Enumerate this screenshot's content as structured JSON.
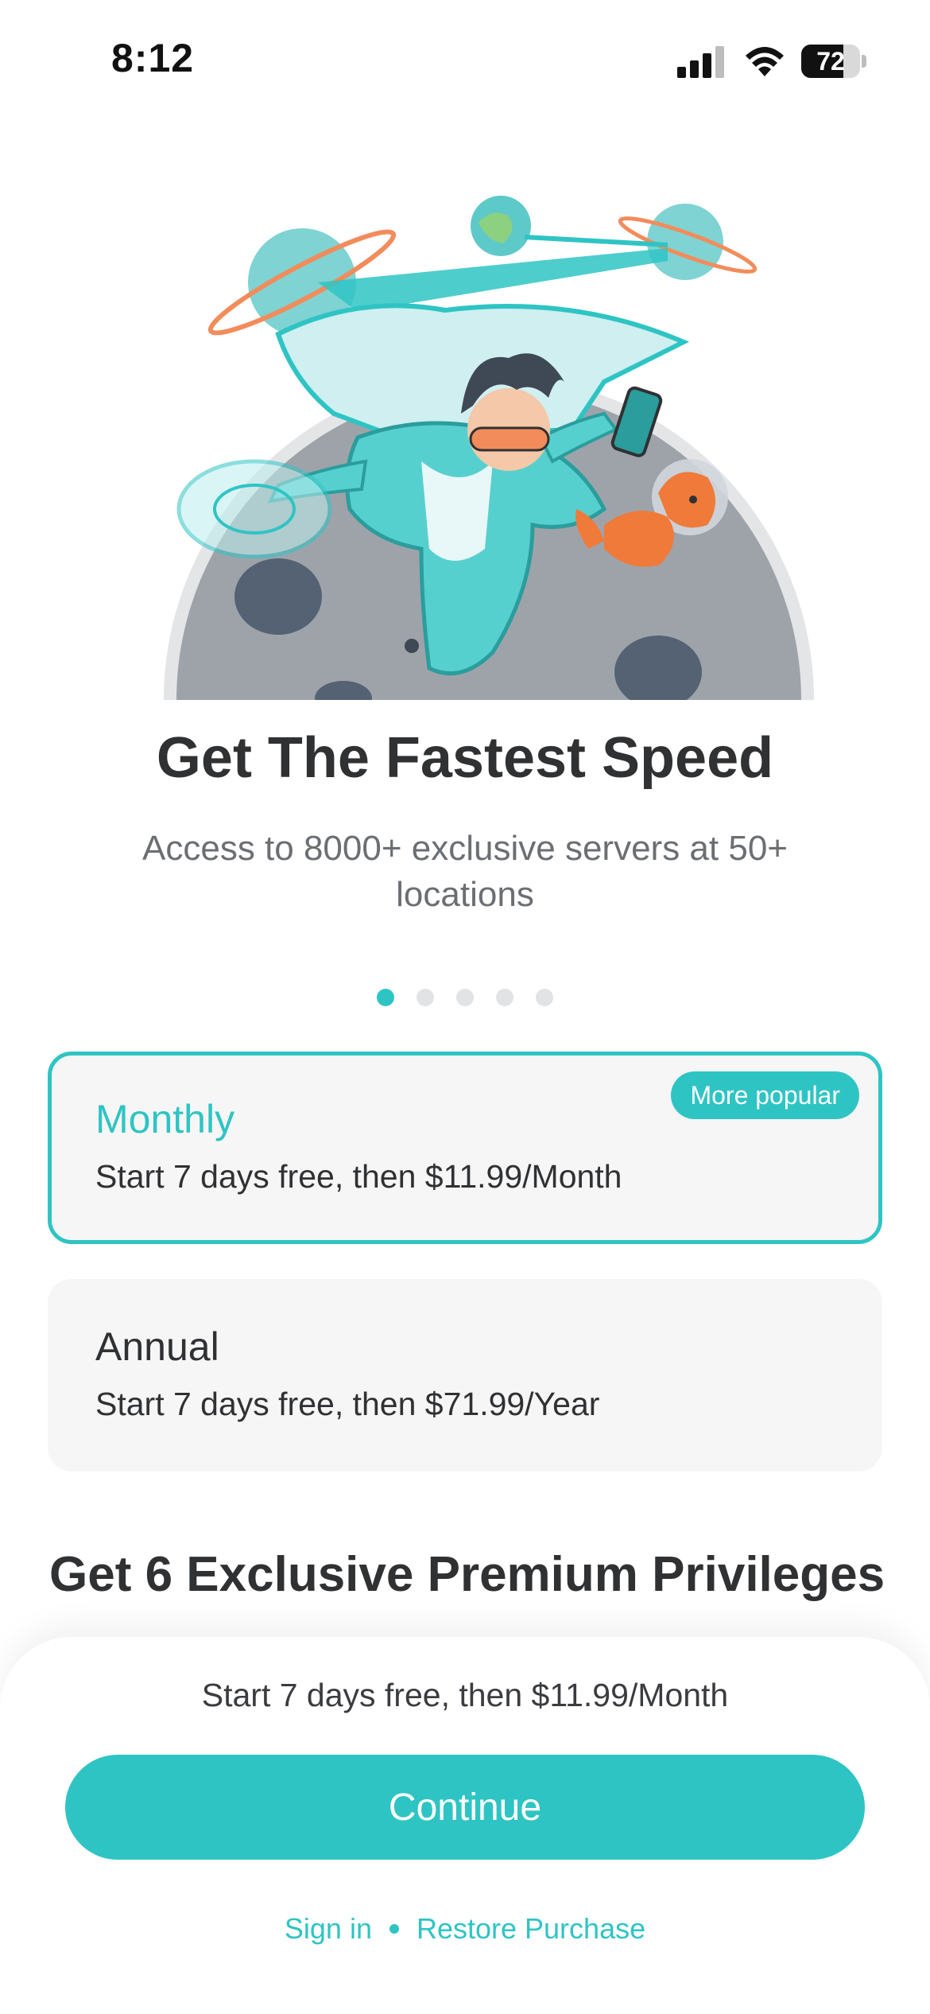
{
  "status_bar": {
    "time": "8:12",
    "battery": "72",
    "battery_level": 0.72
  },
  "icons": {
    "signal": "cellular-signal-icon",
    "wifi": "wifi-icon",
    "hero": "hero-illustration-speed"
  },
  "hero": {
    "headline": "Get The Fastest Speed",
    "subtitle": "Access to 8000+ exclusive servers at 50+ locations"
  },
  "pager": {
    "total": 5,
    "active_index": 0
  },
  "plans": [
    {
      "title": "Monthly",
      "description": "Start 7 days free, then $11.99/Month",
      "badge": "More popular",
      "selected": true
    },
    {
      "title": "Annual",
      "description": "Start 7 days free, then $71.99/Year",
      "selected": false
    }
  ],
  "privileges_heading": "Get 6 Exclusive Premium Privileges",
  "footer": {
    "price_text": "Start 7 days free, then $11.99/Month",
    "continue_label": "Continue",
    "sign_in_label": "Sign in",
    "restore_label": "Restore Purchase"
  },
  "colors": {
    "accent": "#2fc4c4",
    "text": "#2f3133",
    "muted": "#6b6e72",
    "card_bg": "#f6f6f7"
  }
}
